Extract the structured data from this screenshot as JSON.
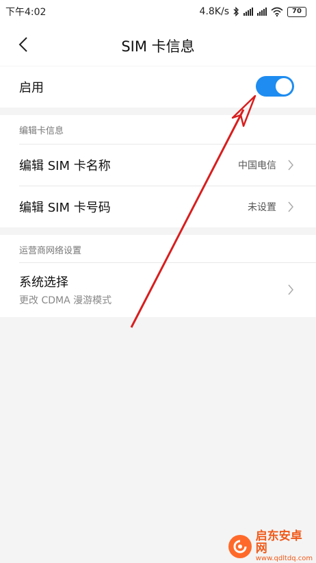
{
  "status_bar": {
    "time": "下午4:02",
    "net_speed": "4.8K/s",
    "battery": "70",
    "icons": [
      "bluetooth-icon",
      "signal-icon",
      "signal-icon",
      "wifi-icon",
      "battery-icon"
    ]
  },
  "header": {
    "title": "SIM 卡信息",
    "back_icon": "chevron-left-icon"
  },
  "enable": {
    "label": "启用",
    "toggle_on": true,
    "accent_color": "#1e8cf0"
  },
  "edit_section": {
    "header": "编辑卡信息",
    "rows": [
      {
        "label": "编辑 SIM 卡名称",
        "value": "中国电信"
      },
      {
        "label": "编辑 SIM 卡号码",
        "value": "未设置"
      }
    ]
  },
  "network_section": {
    "header": "运营商网络设置",
    "rows": [
      {
        "label": "系统选择",
        "sublabel": "更改 CDMA 漫游模式"
      }
    ]
  },
  "annotation": {
    "arrow_color": "#d81e1e"
  },
  "watermark": {
    "text": "启东安卓网",
    "url": "www.qdltdq.com"
  }
}
